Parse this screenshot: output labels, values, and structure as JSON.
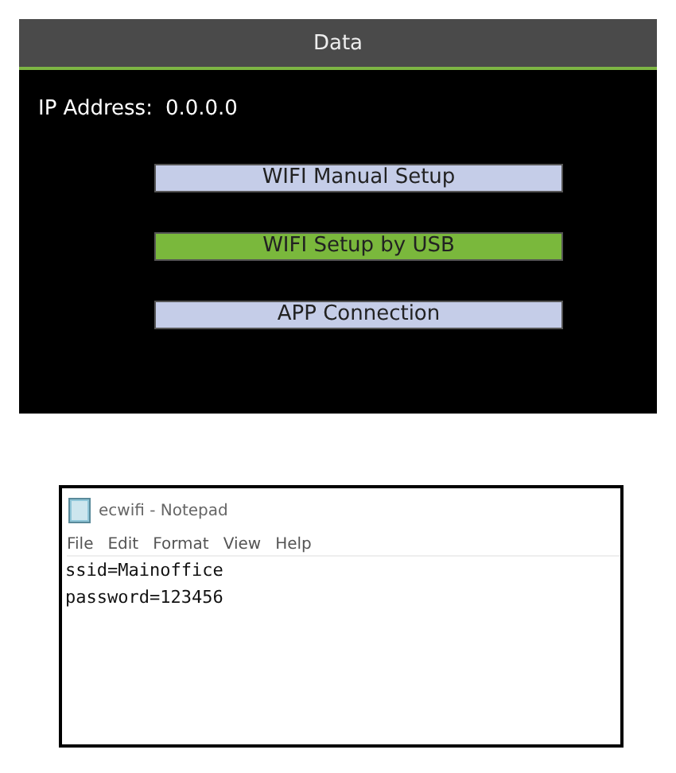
{
  "device_screen": {
    "title": "Data",
    "ip_label": "IP Address:",
    "ip_value": "0.0.0.0",
    "menu": [
      {
        "label": "WIFI Manual Setup",
        "selected": false
      },
      {
        "label": "WIFI Setup by USB",
        "selected": true
      },
      {
        "label": "APP Connection",
        "selected": false
      }
    ]
  },
  "notepad": {
    "title": "ecwifi - Notepad",
    "menu": [
      "File",
      "Edit",
      "Format",
      "View",
      "Help"
    ],
    "lines": [
      "ssid=Mainoffice",
      "password=123456"
    ]
  }
}
